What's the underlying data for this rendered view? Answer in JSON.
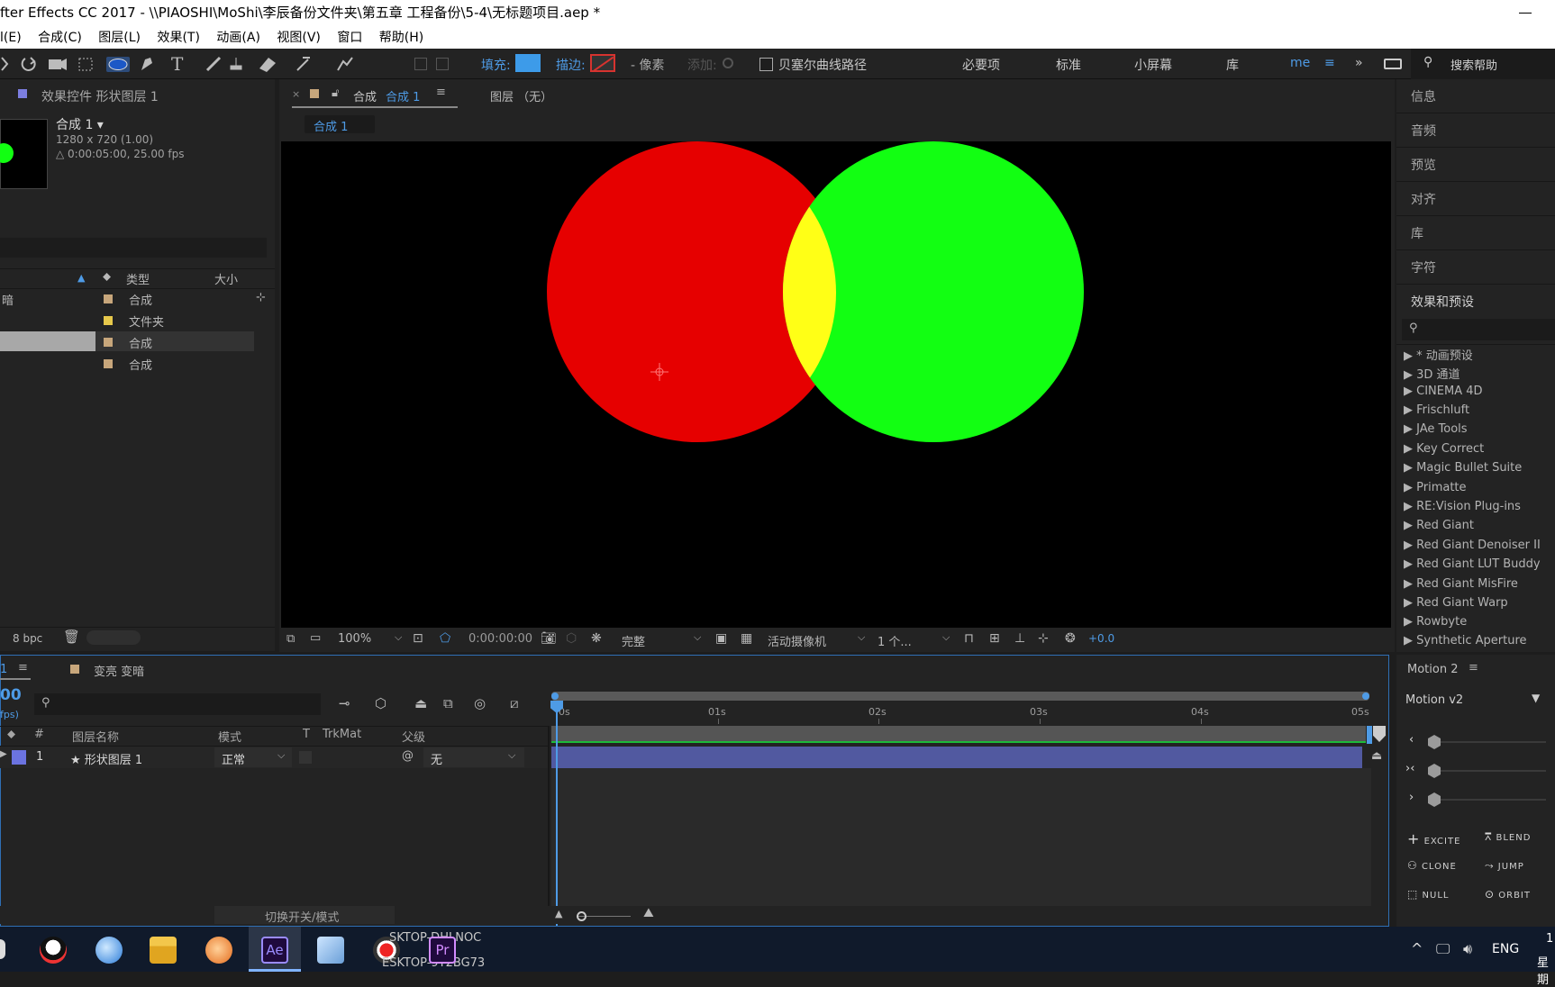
{
  "window": {
    "title": "fter Effects CC 2017 - \\\\PIAOSHI\\MoShi\\李辰备份文件夹\\第五章 工程备份\\5-4\\无标题项目.aep *"
  },
  "menu": [
    "l(E)",
    "合成(C)",
    "图层(L)",
    "效果(T)",
    "动画(A)",
    "视图(V)",
    "窗口",
    "帮助(H)"
  ],
  "toolbar": {
    "fill_label": "填充:",
    "stroke_label": "描边:",
    "px_label": "- 像素",
    "add_label": "添加:",
    "bezier_label": "贝塞尔曲线路径",
    "workspaces": [
      "必要项",
      "标准",
      "小屏幕",
      "库",
      "me"
    ],
    "search_help": "搜索帮助",
    "colors": {
      "fill": "#3d9be9",
      "stroke": "#d7332f"
    }
  },
  "effects_panel": {
    "title": "效果控件 形状图层 1"
  },
  "project": {
    "comp_name": "合成 1 ▾",
    "comp_res": "1280 x 720 (1.00)",
    "comp_dur": "△ 0:00:05:00, 25.00 fps",
    "col_type": "类型",
    "col_size": "大小",
    "rows": [
      {
        "name": "暗",
        "type": "合成",
        "color": "#c7a67b"
      },
      {
        "name": "",
        "type": "文件夹",
        "color": "#e6c84b"
      },
      {
        "name": "",
        "type": "合成",
        "color": "#c7a67b"
      },
      {
        "name": "",
        "type": "合成",
        "color": "#c7a67b"
      }
    ],
    "bpc": "8 bpc"
  },
  "viewer": {
    "tab": "合成 合成 1",
    "tab_prefix": "合成",
    "tab_name": "合成 1",
    "layer_tab": "图层 （无）",
    "crumb": "合成 1",
    "zoom": "100%",
    "timecode": "0:00:00:00",
    "quality": "完整",
    "camera": "活动摄像机",
    "views": "1 个...",
    "exposure": "+0.0",
    "colors": {
      "red": "#e60000",
      "green": "#12ff12",
      "yellow": "#ffff16"
    }
  },
  "right_panel": {
    "items": [
      "信息",
      "音频",
      "预览",
      "对齐",
      "库",
      "字符",
      "效果和预设"
    ],
    "effects": [
      "▶ * 动画预设",
      "▶ 3D 通道",
      "▶ CINEMA 4D",
      "▶ Frischluft",
      "▶ JAe Tools",
      "▶ Key Correct",
      "▶ Magic Bullet Suite",
      "▶ Primatte",
      "▶ RE:Vision Plug-ins",
      "▶ Red Giant",
      "▶ Red Giant Denoiser II",
      "▶ Red Giant LUT Buddy",
      "▶ Red Giant MisFire",
      "▶ Red Giant Warp",
      "▶ Rowbyte",
      "▶ Synthetic Aperture"
    ]
  },
  "timeline": {
    "tab": "1",
    "comp_label": "变亮 变暗",
    "time": "00",
    "fps": "fps)",
    "cols": {
      "num": "#",
      "name": "图层名称",
      "mode": "模式",
      "t": "T",
      "trkmat": "TrkMat",
      "parent": "父级"
    },
    "layer": {
      "num": "1",
      "name": "★ 形状图层 1",
      "mode": "正常",
      "parent": "无",
      "color": "#6b73e0"
    },
    "ticks": [
      "0s",
      "01s",
      "02s",
      "03s",
      "04s",
      "05s"
    ],
    "toggle": "切换开关/模式"
  },
  "motion": {
    "title": "Motion 2",
    "version": "Motion v2",
    "buttons": [
      "EXCITE",
      "BLEND",
      "CLONE",
      "JUMP",
      "NULL",
      "ORBIT"
    ]
  },
  "taskbar": {
    "overlay1": "SKTOP-DHLNOC",
    "overlay2": "ESKTOP-9T2BG73",
    "ime": "ENG",
    "time": "1",
    "day": "星期"
  }
}
